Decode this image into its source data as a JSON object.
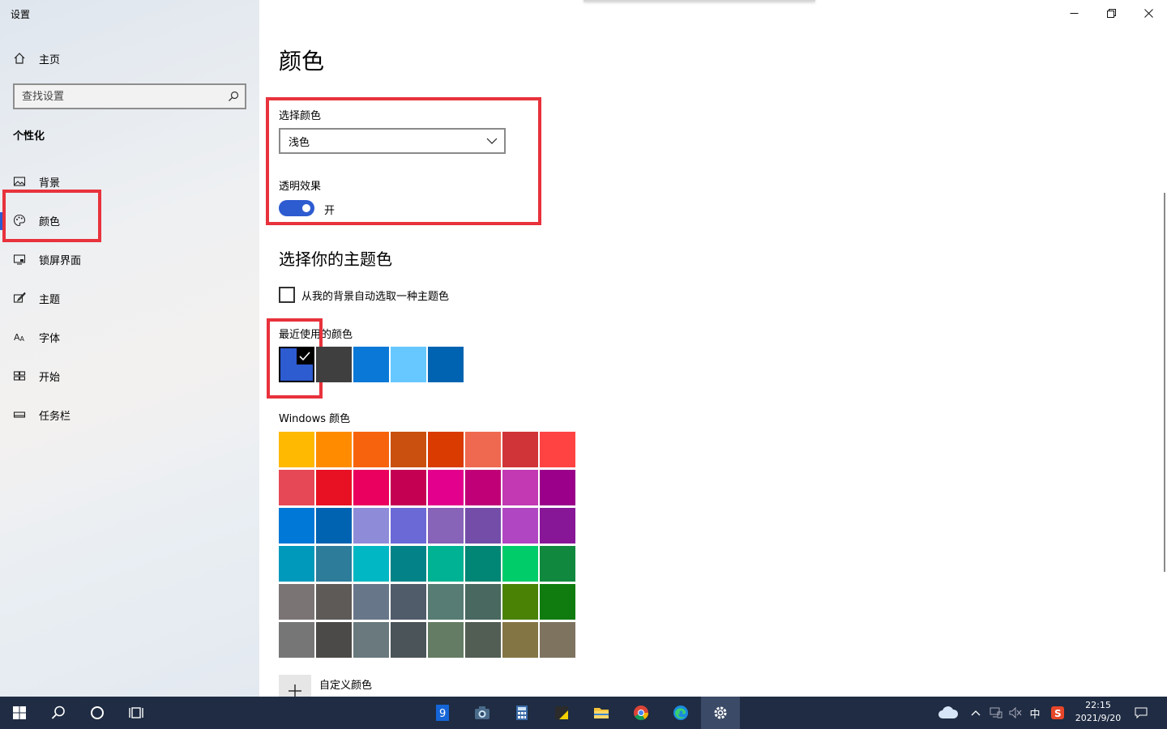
{
  "window": {
    "title": "设置"
  },
  "sidebar": {
    "home_label": "主页",
    "search": {
      "placeholder": "查找设置"
    },
    "section_header": "个性化",
    "items": [
      {
        "label": "背景",
        "icon": "picture-icon"
      },
      {
        "label": "颜色",
        "icon": "palette-icon",
        "selected": true
      },
      {
        "label": "锁屏界面",
        "icon": "lock-screen-icon"
      },
      {
        "label": "主题",
        "icon": "brush-icon"
      },
      {
        "label": "字体",
        "icon": "font-icon"
      },
      {
        "label": "开始",
        "icon": "start-layout-icon"
      },
      {
        "label": "任务栏",
        "icon": "taskbar-icon"
      }
    ],
    "accent_color": "#2d5bd0"
  },
  "main": {
    "title": "颜色",
    "choose_color_label": "选择颜色",
    "mode_value": "浅色",
    "transparency_label": "透明效果",
    "transparency_state": "开",
    "accent_heading": "选择你的主题色",
    "auto_pick_label": "从我的背景自动选取一种主题色",
    "recent_label": "最近使用的颜色",
    "recent_colors": [
      "#2d5bd0",
      "#3f3f3f",
      "#0a78d7",
      "#66c8ff",
      "#0063b1"
    ],
    "windows_label": "Windows 颜色",
    "windows_colors": [
      [
        "#ffb900",
        "#ff8c00",
        "#f7630c",
        "#ca5010",
        "#da3b01",
        "#ef6950",
        "#d13438",
        "#ff4343"
      ],
      [
        "#e74856",
        "#e81123",
        "#ea005e",
        "#c30052",
        "#e3008c",
        "#bf0077",
        "#c239b3",
        "#9a0089"
      ],
      [
        "#0078d7",
        "#0063b1",
        "#8e8cd8",
        "#6b69d6",
        "#8764b8",
        "#744da9",
        "#b146c2",
        "#881798"
      ],
      [
        "#0099bc",
        "#2d7d9a",
        "#00b7c3",
        "#038387",
        "#00b294",
        "#018574",
        "#00cc6a",
        "#10893e"
      ],
      [
        "#7a7574",
        "#5d5a58",
        "#68768a",
        "#515c6b",
        "#567c73",
        "#486860",
        "#498205",
        "#107c10"
      ],
      [
        "#767676",
        "#4c4a48",
        "#69797e",
        "#4a5459",
        "#647c64",
        "#525e54",
        "#847545",
        "#7e735f"
      ]
    ],
    "custom_label": "自定义颜色"
  },
  "taskbar": {
    "clock_time": "22:15",
    "clock_date": "2021/9/20",
    "ime": "中",
    "background": "#1f2c43"
  }
}
